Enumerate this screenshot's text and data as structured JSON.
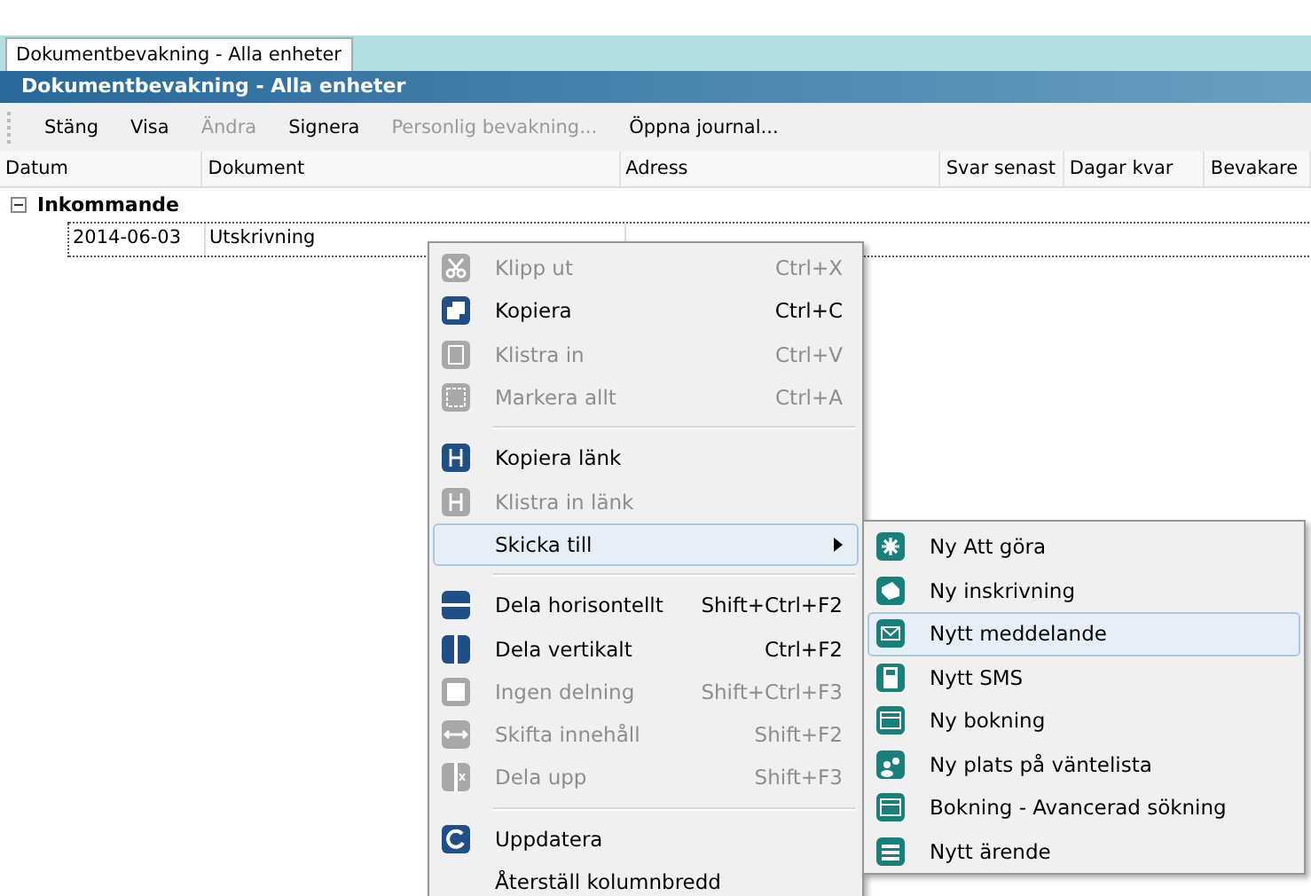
{
  "tab": {
    "label": "Dokumentbevakning - Alla enheter",
    "selected": true
  },
  "title": "Dokumentbevakning - Alla enheter",
  "toolbar": [
    {
      "label": "Stäng",
      "disabled": false
    },
    {
      "label": "Visa",
      "disabled": false
    },
    {
      "label": "Ändra",
      "disabled": true
    },
    {
      "label": "Signera",
      "disabled": false
    },
    {
      "label": "Personlig bevakning...",
      "disabled": true
    },
    {
      "label": "Öppna journal...",
      "disabled": false
    }
  ],
  "table": {
    "columns": [
      "Datum",
      "Dokument",
      "Adress",
      "Svar senast",
      "Dagar kvar",
      "Bevakare"
    ],
    "group": {
      "label": "Inkommande",
      "expanded": true
    },
    "rows": [
      {
        "cells": [
          "2014-06-03",
          "Utskrivning"
        ]
      }
    ]
  },
  "context_menu": [
    {
      "kind": "item",
      "label": "Klipp ut",
      "shortcut": "Ctrl+X",
      "disabled": true,
      "selected": false,
      "submenu": false
    },
    {
      "kind": "item",
      "label": "Kopiera",
      "shortcut": "Ctrl+C",
      "disabled": false,
      "selected": false,
      "submenu": false
    },
    {
      "kind": "item",
      "label": "Klistra in",
      "shortcut": "Ctrl+V",
      "disabled": true,
      "selected": false,
      "submenu": false
    },
    {
      "kind": "item",
      "label": "Markera allt",
      "shortcut": "Ctrl+A",
      "disabled": true,
      "selected": false,
      "submenu": false
    },
    {
      "kind": "separator"
    },
    {
      "kind": "item",
      "label": "Kopiera länk",
      "disabled": false,
      "selected": false,
      "submenu": false
    },
    {
      "kind": "item",
      "label": "Klistra in länk",
      "disabled": true,
      "selected": false,
      "submenu": false
    },
    {
      "kind": "item",
      "label": "Skicka till",
      "disabled": false,
      "selected": true,
      "submenu": true
    },
    {
      "kind": "separator"
    },
    {
      "kind": "item",
      "label": "Dela horisontellt",
      "shortcut": "Shift+Ctrl+F2",
      "disabled": false,
      "selected": false,
      "submenu": false
    },
    {
      "kind": "item",
      "label": "Dela vertikalt",
      "shortcut": "Ctrl+F2",
      "disabled": false,
      "selected": false,
      "submenu": false
    },
    {
      "kind": "item",
      "label": "Ingen delning",
      "shortcut": "Shift+Ctrl+F3",
      "disabled": true,
      "selected": false,
      "submenu": false
    },
    {
      "kind": "item",
      "label": "Skifta innehåll",
      "shortcut": "Shift+F2",
      "disabled": true,
      "selected": false,
      "submenu": false
    },
    {
      "kind": "item",
      "label": "Dela upp",
      "shortcut": "Shift+F3",
      "disabled": true,
      "selected": false,
      "submenu": false
    },
    {
      "kind": "separator"
    },
    {
      "kind": "item",
      "label": "Uppdatera",
      "disabled": false,
      "selected": false,
      "submenu": false
    },
    {
      "kind": "item",
      "label": "Återställ kolumnbredd",
      "disabled": false,
      "selected": false,
      "submenu": false
    }
  ],
  "submenu": [
    {
      "label": "Ny Att göra",
      "selected": false
    },
    {
      "label": "Ny inskrivning",
      "selected": false
    },
    {
      "label": "Nytt meddelande",
      "selected": true
    },
    {
      "label": "Nytt SMS",
      "selected": false
    },
    {
      "label": "Ny bokning",
      "selected": false
    },
    {
      "label": "Ny plats på väntelista",
      "selected": false
    },
    {
      "label": "Bokning - Avancerad sökning",
      "selected": false
    },
    {
      "label": "Nytt ärende",
      "selected": false
    }
  ]
}
